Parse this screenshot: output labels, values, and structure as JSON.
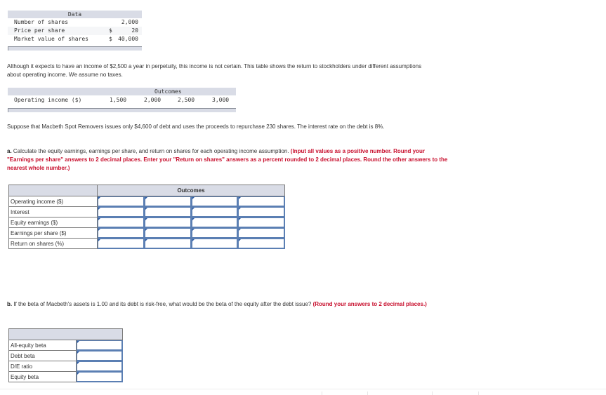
{
  "data_table": {
    "header": "Data",
    "rows": [
      {
        "label": "Number of shares",
        "currency": "",
        "value": "2,000"
      },
      {
        "label": "Price per share",
        "currency": "$",
        "value": "20"
      },
      {
        "label": "Market value of shares",
        "currency": "$",
        "value": "40,000"
      }
    ]
  },
  "intro_text": "Although it expects to have an income of $2,500 a year in perpetuity, this income is not certain. This table shows the return to stockholders under different assumptions about operating income. We assume no taxes.",
  "outcomes_table": {
    "header": "Outcomes",
    "row_label": "Operating income ($)",
    "values": [
      "1,500",
      "2,000",
      "2,500",
      "3,000"
    ]
  },
  "scenario_text": "Suppose that Macbeth Spot Removers issues only $4,600 of debt and uses the proceeds to repurchase 230 shares. The interest rate on the debt is 8%.",
  "part_a": {
    "prefix": "a.",
    "question": " Calculate the equity earnings, earnings per share, and return on shares for each operating income assumption. ",
    "instructions": "(Input all values as a positive number. Round your \"Earnings per share\" answers to 2 decimal places. Enter your \"Return on shares\" answers as a percent rounded to 2 decimal places. Round the other answers to the nearest whole number.)",
    "table": {
      "header": "Outcomes",
      "rows": [
        {
          "label": "Operating income ($)",
          "values": [
            "",
            "",
            "",
            ""
          ]
        },
        {
          "label": "Interest",
          "values": [
            "",
            "",
            "",
            ""
          ]
        },
        {
          "label": "Equity earnings ($)",
          "values": [
            "",
            "",
            "",
            ""
          ]
        },
        {
          "label": "Earnings per share ($)",
          "values": [
            "",
            "",
            "",
            ""
          ]
        },
        {
          "label": "Return on shares (%)",
          "values": [
            "",
            "",
            "",
            ""
          ]
        }
      ]
    }
  },
  "part_b": {
    "prefix": "b.",
    "question": " If the beta of Macbeth's assets is 1.00 and its debt is risk-free, what would be the beta of the equity after the debt issue? ",
    "instructions": "(Round your answers to 2 decimal places.)",
    "table": {
      "rows": [
        {
          "label": "All-equity beta",
          "value": ""
        },
        {
          "label": "Debt beta",
          "value": ""
        },
        {
          "label": "D/E ratio",
          "value": ""
        },
        {
          "label": "Equity beta",
          "value": ""
        }
      ]
    }
  }
}
